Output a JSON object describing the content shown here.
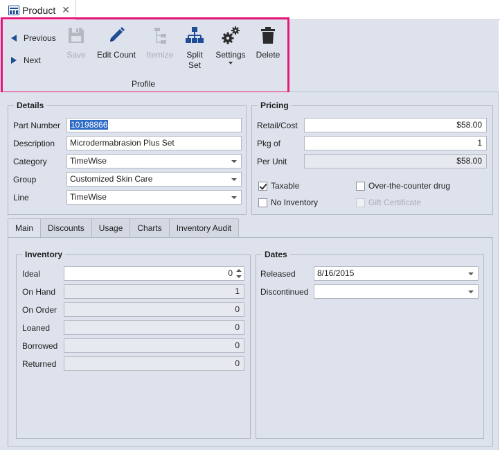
{
  "window": {
    "tab_title": "Product",
    "close_glyph": "✕"
  },
  "ribbon": {
    "previous_label": "Previous",
    "next_label": "Next",
    "buttons": {
      "save": "Save",
      "edit_count": "Edit Count",
      "itemize": "Itemize",
      "split_set": "Split\nSet",
      "settings": "Settings",
      "delete": "Delete"
    },
    "group_label": "Profile",
    "highlight_color": "#e8177a",
    "accent_color": "#1f4e96"
  },
  "details": {
    "title": "Details",
    "part_number_label": "Part Number",
    "part_number_value": "10198866",
    "description_label": "Description",
    "description_value": "Microdermabrasion Plus Set",
    "category_label": "Category",
    "category_value": "TimeWise",
    "group_label": "Group",
    "group_value": "Customized Skin Care",
    "line_label": "Line",
    "line_value": "TimeWise"
  },
  "pricing": {
    "title": "Pricing",
    "retail_label": "Retail/Cost",
    "retail_value": "$58.00",
    "pkg_label": "Pkg of",
    "pkg_value": "1",
    "per_unit_label": "Per Unit",
    "per_unit_value": "$58.00",
    "taxable_label": "Taxable",
    "taxable_checked": true,
    "otc_label": "Over-the-counter drug",
    "otc_checked": false,
    "no_inventory_label": "No Inventory",
    "no_inventory_checked": false,
    "gift_label": "Gift Certificate",
    "gift_checked": false
  },
  "tabs": [
    "Main",
    "Discounts",
    "Usage",
    "Charts",
    "Inventory Audit"
  ],
  "inventory": {
    "title": "Inventory",
    "ideal_label": "Ideal",
    "ideal_value": "0",
    "on_hand_label": "On Hand",
    "on_hand_value": "1",
    "on_order_label": "On Order",
    "on_order_value": "0",
    "loaned_label": "Loaned",
    "loaned_value": "0",
    "borrowed_label": "Borrowed",
    "borrowed_value": "0",
    "returned_label": "Returned",
    "returned_value": "0"
  },
  "dates": {
    "title": "Dates",
    "released_label": "Released",
    "released_value": "8/16/2015",
    "discontinued_label": "Discontinued",
    "discontinued_value": ""
  }
}
